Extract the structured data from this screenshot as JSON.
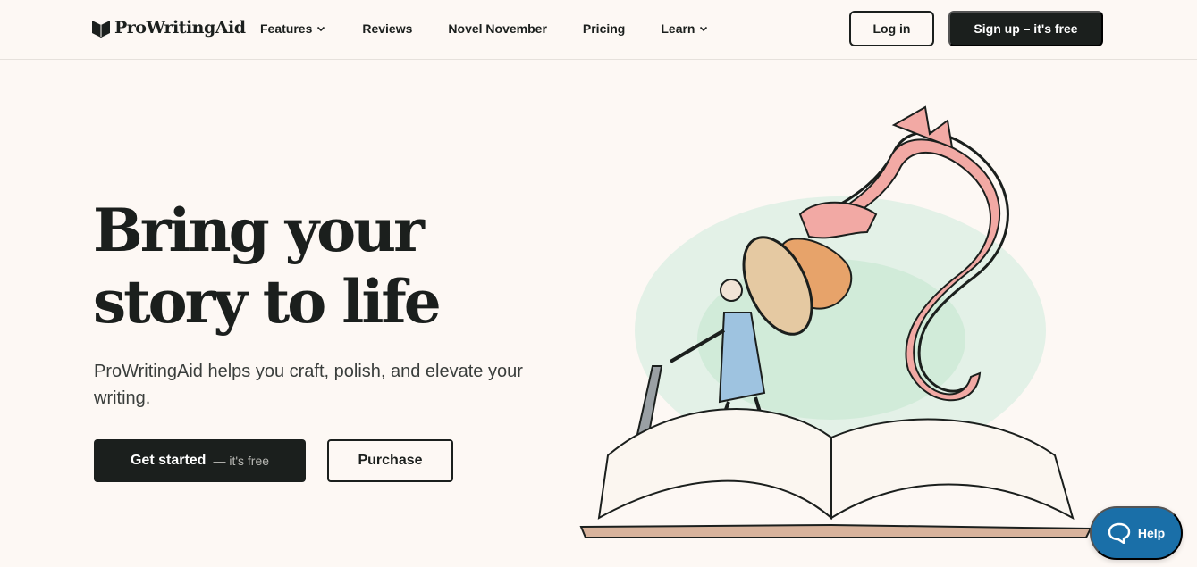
{
  "header": {
    "logo_text": "ProWritingAid",
    "nav": [
      {
        "label": "Features",
        "has_dropdown": true
      },
      {
        "label": "Reviews",
        "has_dropdown": false
      },
      {
        "label": "Novel November",
        "has_dropdown": false
      },
      {
        "label": "Pricing",
        "has_dropdown": false
      },
      {
        "label": "Learn",
        "has_dropdown": true
      }
    ],
    "login_label": "Log in",
    "signup_label": "Sign up – it's free"
  },
  "hero": {
    "title_line1": "Bring your",
    "title_line2": "story to life",
    "subtitle": "ProWritingAid helps you craft, polish, and elevate your writing.",
    "cta_primary": "Get started",
    "cta_primary_suffix": "— it's free",
    "cta_secondary": "Purchase"
  },
  "help": {
    "label": "Help",
    "icon": "chat-bubble-icon"
  },
  "colors": {
    "background": "#fdf8f4",
    "text": "#1b1f1d",
    "help_blue": "#1a6fa8",
    "dragon_pink": "#f2a9a4",
    "knight_blue": "#9ec3e0"
  }
}
